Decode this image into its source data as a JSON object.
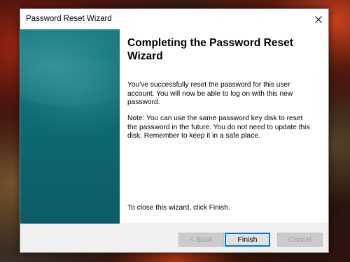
{
  "window": {
    "title": "Password Reset Wizard"
  },
  "main": {
    "heading": "Completing the Password Reset Wizard",
    "paragraph1": "You've successfully reset the password for this user account. You will now be able to log on with this new password.",
    "paragraph2": "Note: You can use the same password key disk to reset the password in the future. You do not need to update this disk. Remember to keep it in a safe place.",
    "paragraph3": "To close this wizard, click Finish."
  },
  "buttons": {
    "back": "< Back",
    "finish": "Finish",
    "cancel": "Cancel"
  },
  "icons": {
    "close": "close-icon"
  },
  "colors": {
    "side_panel": "#0f6a73",
    "primary_border": "#0078d7"
  }
}
